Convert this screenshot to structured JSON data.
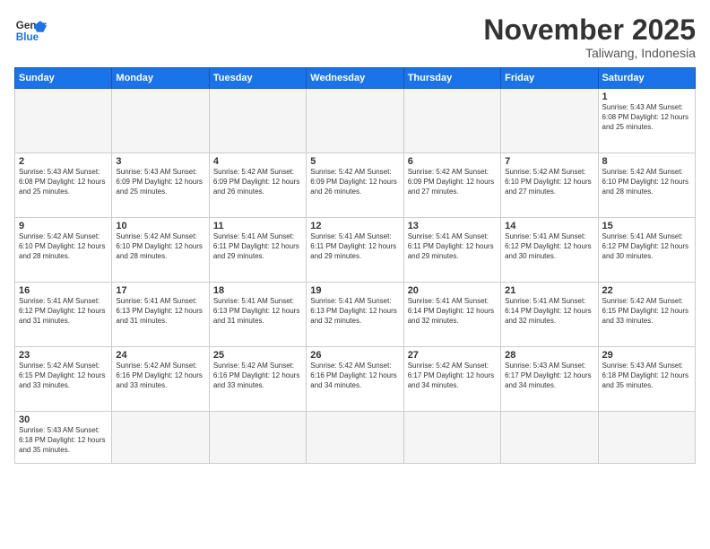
{
  "header": {
    "logo_general": "General",
    "logo_blue": "Blue",
    "month_title": "November 2025",
    "subtitle": "Taliwang, Indonesia"
  },
  "weekdays": [
    "Sunday",
    "Monday",
    "Tuesday",
    "Wednesday",
    "Thursday",
    "Friday",
    "Saturday"
  ],
  "weeks": [
    [
      {
        "day": "",
        "info": ""
      },
      {
        "day": "",
        "info": ""
      },
      {
        "day": "",
        "info": ""
      },
      {
        "day": "",
        "info": ""
      },
      {
        "day": "",
        "info": ""
      },
      {
        "day": "",
        "info": ""
      },
      {
        "day": "1",
        "info": "Sunrise: 5:43 AM\nSunset: 6:08 PM\nDaylight: 12 hours\nand 25 minutes."
      }
    ],
    [
      {
        "day": "2",
        "info": "Sunrise: 5:43 AM\nSunset: 6:08 PM\nDaylight: 12 hours\nand 25 minutes."
      },
      {
        "day": "3",
        "info": "Sunrise: 5:43 AM\nSunset: 6:09 PM\nDaylight: 12 hours\nand 25 minutes."
      },
      {
        "day": "4",
        "info": "Sunrise: 5:42 AM\nSunset: 6:09 PM\nDaylight: 12 hours\nand 26 minutes."
      },
      {
        "day": "5",
        "info": "Sunrise: 5:42 AM\nSunset: 6:09 PM\nDaylight: 12 hours\nand 26 minutes."
      },
      {
        "day": "6",
        "info": "Sunrise: 5:42 AM\nSunset: 6:09 PM\nDaylight: 12 hours\nand 27 minutes."
      },
      {
        "day": "7",
        "info": "Sunrise: 5:42 AM\nSunset: 6:10 PM\nDaylight: 12 hours\nand 27 minutes."
      },
      {
        "day": "8",
        "info": "Sunrise: 5:42 AM\nSunset: 6:10 PM\nDaylight: 12 hours\nand 28 minutes."
      }
    ],
    [
      {
        "day": "9",
        "info": "Sunrise: 5:42 AM\nSunset: 6:10 PM\nDaylight: 12 hours\nand 28 minutes."
      },
      {
        "day": "10",
        "info": "Sunrise: 5:42 AM\nSunset: 6:10 PM\nDaylight: 12 hours\nand 28 minutes."
      },
      {
        "day": "11",
        "info": "Sunrise: 5:41 AM\nSunset: 6:11 PM\nDaylight: 12 hours\nand 29 minutes."
      },
      {
        "day": "12",
        "info": "Sunrise: 5:41 AM\nSunset: 6:11 PM\nDaylight: 12 hours\nand 29 minutes."
      },
      {
        "day": "13",
        "info": "Sunrise: 5:41 AM\nSunset: 6:11 PM\nDaylight: 12 hours\nand 29 minutes."
      },
      {
        "day": "14",
        "info": "Sunrise: 5:41 AM\nSunset: 6:12 PM\nDaylight: 12 hours\nand 30 minutes."
      },
      {
        "day": "15",
        "info": "Sunrise: 5:41 AM\nSunset: 6:12 PM\nDaylight: 12 hours\nand 30 minutes."
      }
    ],
    [
      {
        "day": "16",
        "info": "Sunrise: 5:41 AM\nSunset: 6:12 PM\nDaylight: 12 hours\nand 31 minutes."
      },
      {
        "day": "17",
        "info": "Sunrise: 5:41 AM\nSunset: 6:13 PM\nDaylight: 12 hours\nand 31 minutes."
      },
      {
        "day": "18",
        "info": "Sunrise: 5:41 AM\nSunset: 6:13 PM\nDaylight: 12 hours\nand 31 minutes."
      },
      {
        "day": "19",
        "info": "Sunrise: 5:41 AM\nSunset: 6:13 PM\nDaylight: 12 hours\nand 32 minutes."
      },
      {
        "day": "20",
        "info": "Sunrise: 5:41 AM\nSunset: 6:14 PM\nDaylight: 12 hours\nand 32 minutes."
      },
      {
        "day": "21",
        "info": "Sunrise: 5:41 AM\nSunset: 6:14 PM\nDaylight: 12 hours\nand 32 minutes."
      },
      {
        "day": "22",
        "info": "Sunrise: 5:42 AM\nSunset: 6:15 PM\nDaylight: 12 hours\nand 33 minutes."
      }
    ],
    [
      {
        "day": "23",
        "info": "Sunrise: 5:42 AM\nSunset: 6:15 PM\nDaylight: 12 hours\nand 33 minutes."
      },
      {
        "day": "24",
        "info": "Sunrise: 5:42 AM\nSunset: 6:16 PM\nDaylight: 12 hours\nand 33 minutes."
      },
      {
        "day": "25",
        "info": "Sunrise: 5:42 AM\nSunset: 6:16 PM\nDaylight: 12 hours\nand 33 minutes."
      },
      {
        "day": "26",
        "info": "Sunrise: 5:42 AM\nSunset: 6:16 PM\nDaylight: 12 hours\nand 34 minutes."
      },
      {
        "day": "27",
        "info": "Sunrise: 5:42 AM\nSunset: 6:17 PM\nDaylight: 12 hours\nand 34 minutes."
      },
      {
        "day": "28",
        "info": "Sunrise: 5:43 AM\nSunset: 6:17 PM\nDaylight: 12 hours\nand 34 minutes."
      },
      {
        "day": "29",
        "info": "Sunrise: 5:43 AM\nSunset: 6:18 PM\nDaylight: 12 hours\nand 35 minutes."
      }
    ],
    [
      {
        "day": "30",
        "info": "Sunrise: 5:43 AM\nSunset: 6:18 PM\nDaylight: 12 hours\nand 35 minutes."
      },
      {
        "day": "",
        "info": ""
      },
      {
        "day": "",
        "info": ""
      },
      {
        "day": "",
        "info": ""
      },
      {
        "day": "",
        "info": ""
      },
      {
        "day": "",
        "info": ""
      },
      {
        "day": "",
        "info": ""
      }
    ]
  ]
}
